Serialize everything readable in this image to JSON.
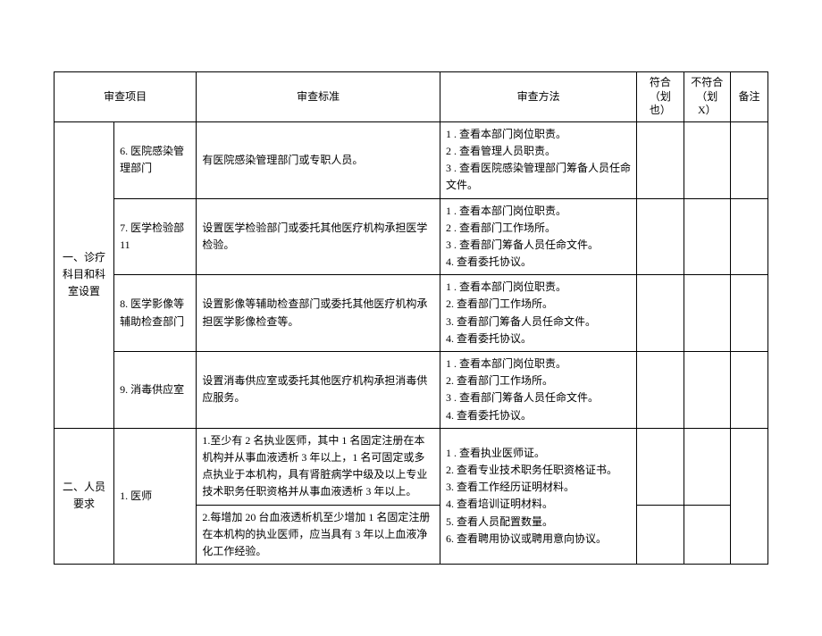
{
  "headers": {
    "item": "审查项目",
    "standard": "审查标准",
    "method": "审查方法",
    "conform": "符合",
    "conform_sub": "（划也）",
    "nonconform": "不符合",
    "nonconform_sub": "（划 X）",
    "note": "备注"
  },
  "categories": {
    "cat1": "一、诊疗科目和科室设置",
    "cat2": "二、人员要求"
  },
  "rows": {
    "r6": {
      "sub": "6. 医院感染管理部门",
      "std": "有医院感染管理部门或专职人员。",
      "method": "1  . 查看本部门岗位职责。\n2  . 查看管理人员职责。\n3  . 查看医院感染管理部门筹备人员任命文件。"
    },
    "r7": {
      "sub": "7. 医学检验部11",
      "std": "设置医学检验部门或委托其他医疗机构承担医学检验。",
      "method": "1  . 查看本部门岗位职责。\n2  . 查看部门工作场所。\n3  . 查看部门筹备人员任命文件。\n4. 查看委托协议。"
    },
    "r8": {
      "sub": "8. 医学影像等辅助检查部门",
      "std": "设置影像等辅助检查部门或委托其他医疗机构承担医学影像检查等。",
      "method": "1  . 查看本部门岗位职责。\n2. 查看部门工作场所。\n3. 查看部门筹备人员任命文件。\n4. 查看委托协议。"
    },
    "r9": {
      "sub": "9. 消毒供应室",
      "std": "设置消毒供应室或委托其他医疗机构承担消毒供应服务。",
      "method": "1  . 查看本部门岗位职责。\n2. 查看部门工作场所。\n3  . 查看部门筹备人员任命文件。\n4. 查看委托协议。"
    },
    "r_p1": {
      "sub": "1. 医师",
      "std_a": "1.至少有 2 名执业医师，其中 1 名固定注册在本机构并从事血液透析 3 年以上，1 名可固定或多点执业于本机构，具有肾脏病学中级及以上专业技术职务任职资格并从事血液透析 3 年以上。",
      "std_b": "2.每增加 20 台血液透析机至少增加 1 名固定注册在本机构的执业医师，应当具有 3 年以上血液净化工作经验。",
      "method": "1  . 查看执业医师证。\n2. 查看专业技术职务任职资格证书。\n3. 查看工作经历证明材料。\n4. 查看培训证明材料。\n5. 查看人员配置数量。\n6. 查看聘用协议或聘用意向协议。"
    }
  }
}
